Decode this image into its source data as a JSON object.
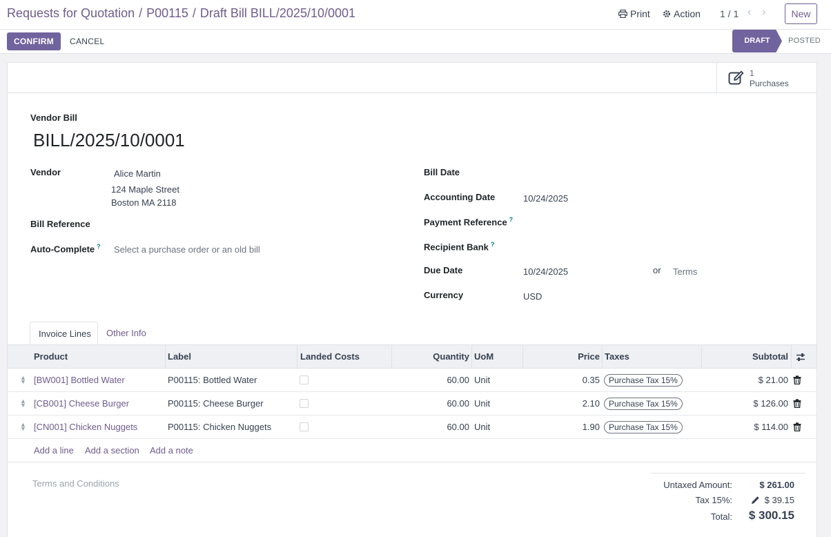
{
  "breadcrumb": {
    "items": [
      "Requests for Quotation",
      "P00115"
    ],
    "separator": "/",
    "current": "Draft Bill BILL/2025/10/0001"
  },
  "header_actions": {
    "print_label": "Print",
    "action_label": "Action",
    "pager": "1 / 1",
    "new_label": "New"
  },
  "control": {
    "confirm_label": "CONFIRM",
    "cancel_label": "CANCEL",
    "status_draft": "DRAFT",
    "status_posted": "POSTED"
  },
  "smart_button": {
    "count": "1",
    "label": "Purchases"
  },
  "document": {
    "kind": "Vendor Bill",
    "name": "BILL/2025/10/0001"
  },
  "left_fields": {
    "vendor_label": "Vendor",
    "vendor_name": "Alice Martin",
    "vendor_address_1": "124 Maple Street",
    "vendor_address_2": "Boston MA 2118",
    "bill_reference_label": "Bill Reference",
    "auto_complete_label": "Auto-Complete",
    "auto_complete_placeholder": "Select a purchase order or an old bill",
    "help_mark": "?"
  },
  "right_fields": {
    "bill_date_label": "Bill Date",
    "accounting_date_label": "Accounting Date",
    "accounting_date_value": "10/24/2025",
    "payment_reference_label": "Payment Reference",
    "recipient_bank_label": "Recipient Bank",
    "due_date_label": "Due Date",
    "due_date_value": "10/24/2025",
    "or_text": "or",
    "terms_placeholder": "Terms",
    "currency_label": "Currency",
    "currency_value": "USD"
  },
  "tabs": [
    "Invoice Lines",
    "Other Info"
  ],
  "table": {
    "headers": {
      "product": "Product",
      "label": "Label",
      "landed_costs": "Landed Costs",
      "quantity": "Quantity",
      "uom": "UoM",
      "price": "Price",
      "taxes": "Taxes",
      "subtotal": "Subtotal"
    },
    "rows": [
      {
        "product": "[BW001] Bottled Water",
        "label": "P00115: Bottled Water",
        "quantity": "60.00",
        "uom": "Unit",
        "price": "0.35",
        "tax": "Purchase Tax 15%",
        "subtotal": "$ 21.00"
      },
      {
        "product": "[CB001] Cheese Burger",
        "label": "P00115: Cheese Burger",
        "quantity": "60.00",
        "uom": "Unit",
        "price": "2.10",
        "tax": "Purchase Tax 15%",
        "subtotal": "$ 126.00"
      },
      {
        "product": "[CN001] Chicken Nuggets",
        "label": "P00115: Chicken Nuggets",
        "quantity": "60.00",
        "uom": "Unit",
        "price": "1.90",
        "tax": "Purchase Tax 15%",
        "subtotal": "$ 114.00"
      }
    ],
    "add_line": "Add a line",
    "add_section": "Add a section",
    "add_note": "Add a note"
  },
  "terms_placeholder": "Terms and Conditions",
  "totals": {
    "untaxed_label": "Untaxed Amount:",
    "untaxed_value": "$ 261.00",
    "tax_label": "Tax 15%:",
    "tax_value": "$ 39.15",
    "total_label": "Total:",
    "total_value": "$ 300.15"
  },
  "colors": {
    "primary": "#71639e",
    "link": "#6f5c8d"
  },
  "icons": [
    "print-icon",
    "gear-icon",
    "chevron-left-icon",
    "chevron-right-icon",
    "edit-icon",
    "drag-handle-icon",
    "trash-icon",
    "column-settings-icon",
    "pencil-icon"
  ]
}
